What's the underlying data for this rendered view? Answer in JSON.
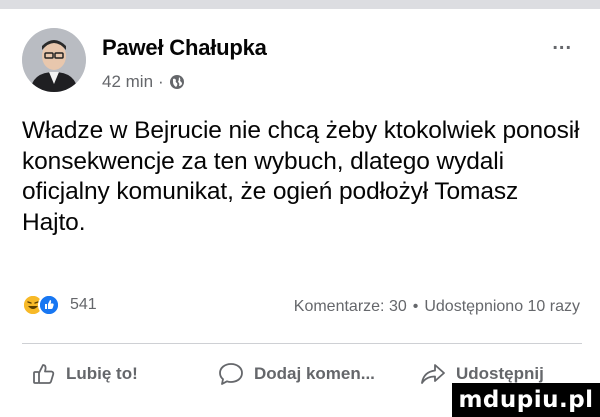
{
  "post": {
    "author": "Paweł Chałupka",
    "time": "42 min",
    "separator": "·",
    "privacy_icon": "globe-icon",
    "more_icon": "more-options-icon",
    "more_label": "...",
    "text": "Władze w Bejrucie nie chcą żeby ktokolwiek ponosił konsekwencje za ten wybuch, dlatego wydali oficjalny komunikat, że ogień podłożył Tomasz Hajto."
  },
  "stats": {
    "reactions": [
      "laugh-icon",
      "like-icon"
    ],
    "reactions_count": "541",
    "comments": "Komentarze: 30",
    "dot": "•",
    "shares": "Udostępniono 10 razy"
  },
  "actions": {
    "like_label": "Lubię to!",
    "comment_label": "Dodaj komen...",
    "share_label": "Udostępnij"
  },
  "watermark": {
    "text": "mdupiu.pl"
  },
  "colors": {
    "text": "#050505",
    "secondary": "#65676b",
    "like_blue": "#1877f2",
    "laugh_yellow": "#f7b928",
    "divider": "#ced0d4"
  }
}
